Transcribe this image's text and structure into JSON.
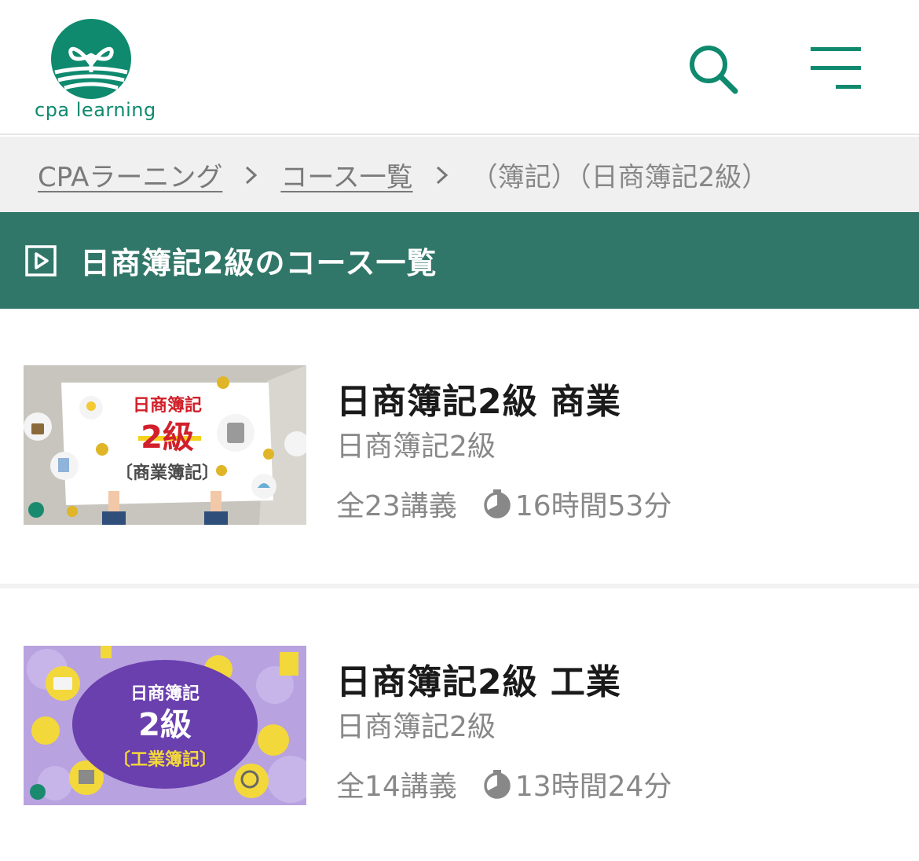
{
  "header": {
    "logo_text": "cpa learning",
    "brand_color": "#0f8a6e",
    "search_icon": "search-icon",
    "menu_icon": "hamburger-menu-icon"
  },
  "breadcrumb": {
    "items": [
      {
        "label": "CPAラーニング"
      },
      {
        "label": "コース一覧"
      }
    ],
    "current": "（簿記）（日商簿記2級）"
  },
  "section": {
    "title": "日商簿記2級のコース一覧",
    "icon": "play-icon",
    "bg_color": "#317769"
  },
  "courses": [
    {
      "title": "日商簿記2級 商業",
      "subtitle": "日商簿記2級",
      "lectures": "全23講義",
      "duration": "16時間53分",
      "thumb": {
        "line1": "日商簿記",
        "line2": "2級",
        "line3": "〔商業簿記〕"
      }
    },
    {
      "title": "日商簿記2級 工業",
      "subtitle": "日商簿記2級",
      "lectures": "全14講義",
      "duration": "13時間24分",
      "thumb": {
        "line1": "日商簿記",
        "line2": "2級",
        "line3": "〔工業簿記〕"
      }
    }
  ]
}
